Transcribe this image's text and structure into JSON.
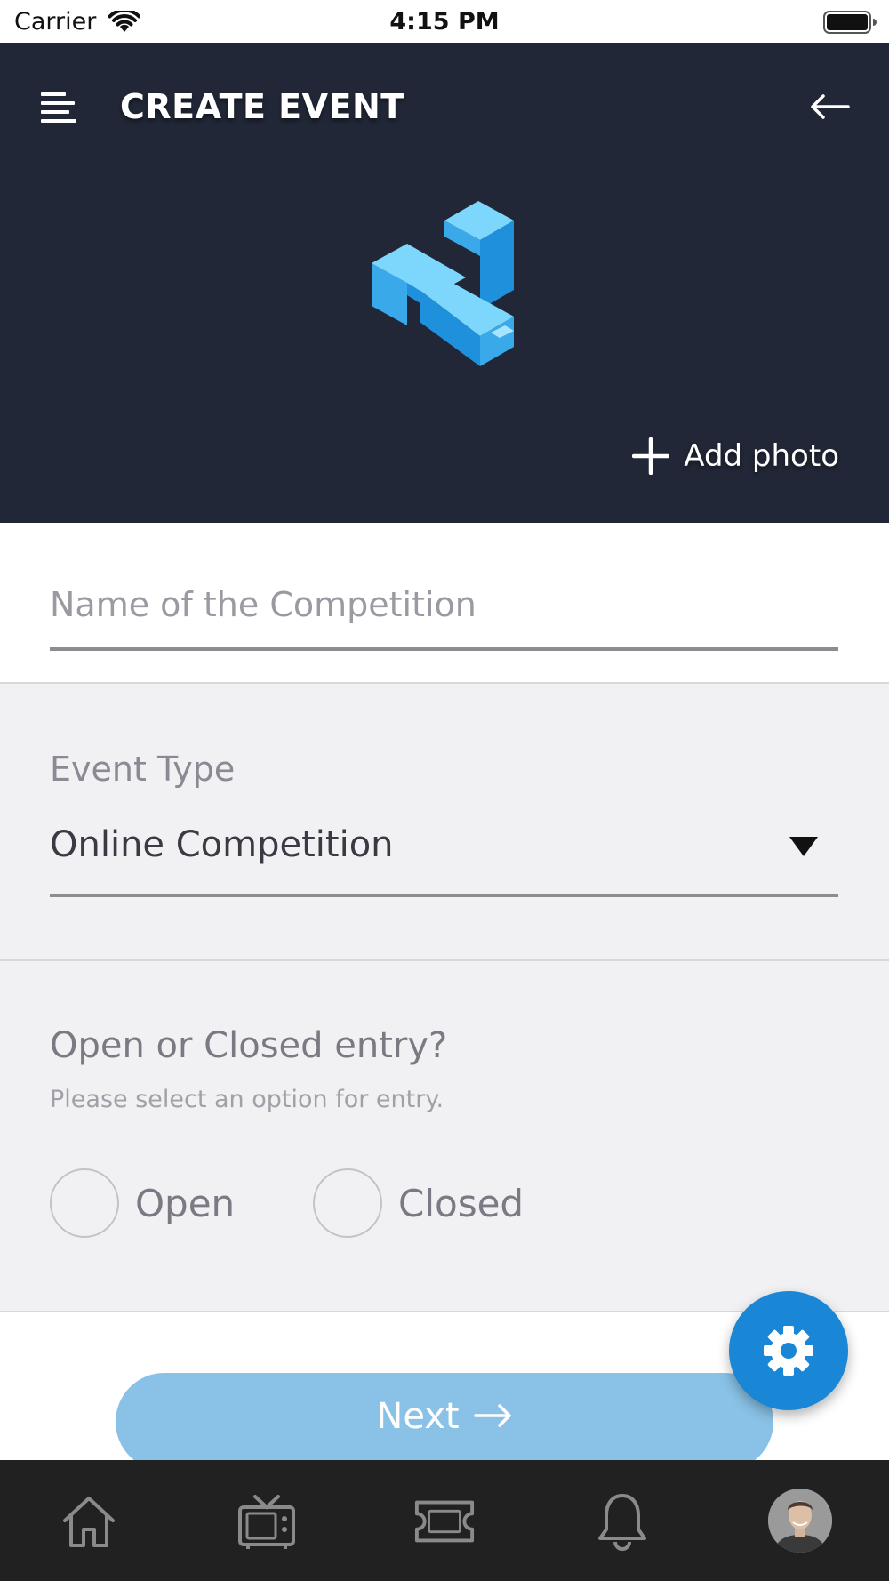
{
  "status_bar": {
    "carrier": "Carrier",
    "time": "4:15 PM"
  },
  "header": {
    "title": "CREATE EVENT",
    "add_photo_label": "Add photo",
    "background_color": "#212736",
    "logo_color": "#1a86d6"
  },
  "form": {
    "name_field": {
      "placeholder": "Name of the Competition",
      "value": ""
    },
    "event_type": {
      "label": "Event Type",
      "selected": "Online Competition"
    },
    "entry": {
      "title": "Open or Closed entry?",
      "subtitle": "Please select an option for entry.",
      "options": [
        {
          "label": "Open",
          "selected": false
        },
        {
          "label": "Closed",
          "selected": false
        }
      ]
    }
  },
  "actions": {
    "next_label": "Next",
    "next_color": "#89c2e6",
    "fab_icon": "gear-icon",
    "fab_color": "#1a86d6"
  },
  "bottom_nav": {
    "items": [
      {
        "icon": "home-icon"
      },
      {
        "icon": "tv-icon"
      },
      {
        "icon": "ticket-icon"
      },
      {
        "icon": "bell-icon"
      },
      {
        "icon": "profile-avatar"
      }
    ]
  }
}
